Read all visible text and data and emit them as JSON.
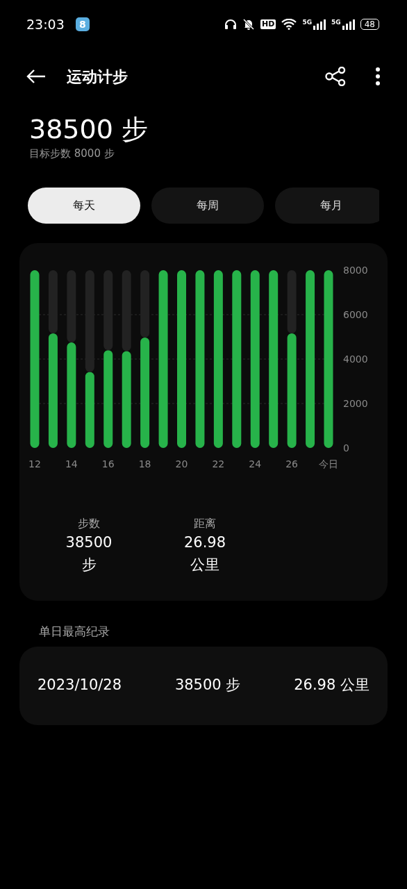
{
  "status_bar": {
    "time": "23:03",
    "app_badge": "8",
    "hd": "HD",
    "signals": [
      "5G",
      "5G"
    ],
    "battery": "48"
  },
  "header": {
    "title": "运动计步"
  },
  "summary": {
    "total": "38500 步",
    "goal": "目标步数 8000 步"
  },
  "tabs": [
    {
      "label": "每天",
      "selected": true
    },
    {
      "label": "每周",
      "selected": false
    },
    {
      "label": "每月",
      "selected": false
    }
  ],
  "chart": {
    "chart_data": {
      "type": "bar",
      "x": [
        12,
        13,
        14,
        15,
        16,
        17,
        18,
        19,
        20,
        21,
        22,
        23,
        24,
        25,
        26,
        27,
        28
      ],
      "stacked": true,
      "series": [
        {
          "color": "#27b34a",
          "values": [
            8000,
            5160,
            4750,
            3420,
            4400,
            4360,
            4970,
            8000,
            8000,
            8000,
            8000,
            8000,
            8000,
            8000,
            5160,
            8000,
            8000
          ]
        },
        {
          "color": "#222222",
          "values": [
            0,
            2840,
            3250,
            4580,
            3600,
            3640,
            3030,
            0,
            0,
            0,
            0,
            0,
            0,
            0,
            2840,
            0,
            0
          ]
        }
      ],
      "xlim": [
        12,
        28
      ],
      "grid": true,
      "ylim": [
        0,
        8000
      ],
      "yticks": [
        0,
        2000,
        4000,
        6000,
        8000
      ],
      "xticks": [
        {
          "value": 12,
          "label": "12"
        },
        {
          "value": 14,
          "label": "14"
        },
        {
          "value": 16,
          "label": "16"
        },
        {
          "value": 18,
          "label": "18"
        },
        {
          "value": 20,
          "label": "20"
        },
        {
          "value": 22,
          "label": "22"
        },
        {
          "value": 24,
          "label": "24"
        },
        {
          "value": 26,
          "label": "26"
        },
        {
          "value": 28,
          "label": "今日"
        }
      ]
    },
    "stats": [
      {
        "label": "步数",
        "value": "38500",
        "unit": "步"
      },
      {
        "label": "距离",
        "value": "26.98",
        "unit": "公里"
      }
    ]
  },
  "record": {
    "title": "单日最高纪录",
    "date": "2023/10/28",
    "steps": "38500 步",
    "distance": "26.98 公里"
  }
}
